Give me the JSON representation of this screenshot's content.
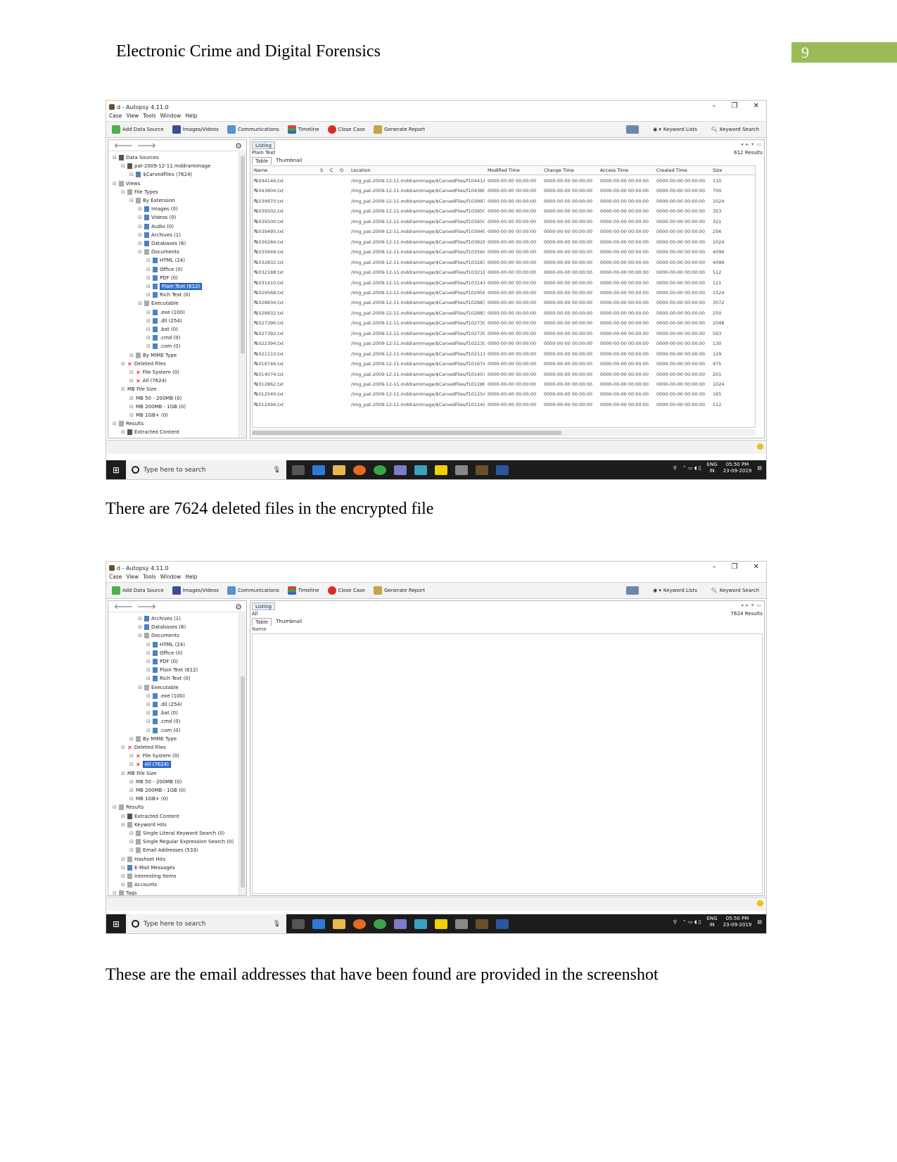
{
  "header": {
    "title": "Electronic Crime and Digital Forensics",
    "page_number": "9"
  },
  "captions": [
    "There are 7624 deleted files in the encrypted file",
    "These are the email addresses that have been found are provided in the screenshot"
  ],
  "app": {
    "window_title": "d - Autopsy 4.11.0",
    "menu": [
      "Case",
      "View",
      "Tools",
      "Window",
      "Help"
    ],
    "toolbar": {
      "add_data_source": "Add Data Source",
      "images_videos": "Images/Videos",
      "communications": "Communications",
      "timeline": "Timeline",
      "close_case": "Close Case",
      "generate_report": "Generate Report",
      "keyword_lists": "Keyword Lists",
      "keyword_search": "Keyword Search"
    },
    "taskbar": {
      "search_placeholder": "Type here to search",
      "lang": "ENG",
      "region": "IN",
      "time": "05:50 PM",
      "date": "23-09-2019"
    }
  },
  "shot1": {
    "tree": [
      {
        "label": "Data Sources",
        "level": 0,
        "icon": "disk"
      },
      {
        "label": "pat-2009-12-11.mddramimage",
        "level": 1,
        "icon": "disk"
      },
      {
        "label": "$CarvedFiles (7624)",
        "level": 2,
        "icon": "folder"
      },
      {
        "label": "Views",
        "level": 0,
        "icon": "gray"
      },
      {
        "label": "File Types",
        "level": 1,
        "icon": "gray"
      },
      {
        "label": "By Extension",
        "level": 2,
        "icon": "gray"
      },
      {
        "label": "Images (0)",
        "level": 3,
        "icon": "folder"
      },
      {
        "label": "Videos (0)",
        "level": 3,
        "icon": "folder"
      },
      {
        "label": "Audio (0)",
        "level": 3,
        "icon": "folder"
      },
      {
        "label": "Archives (1)",
        "level": 3,
        "icon": "folder"
      },
      {
        "label": "Databases (6)",
        "level": 3,
        "icon": "folder"
      },
      {
        "label": "Documents",
        "level": 3,
        "icon": "gray"
      },
      {
        "label": "HTML (24)",
        "level": 4,
        "icon": "folder"
      },
      {
        "label": "Office (0)",
        "level": 4,
        "icon": "folder"
      },
      {
        "label": "PDF (0)",
        "level": 4,
        "icon": "folder"
      },
      {
        "label": "Plain Text (612)",
        "level": 4,
        "icon": "folder",
        "selected": true
      },
      {
        "label": "Rich Text (0)",
        "level": 4,
        "icon": "folder"
      },
      {
        "label": "Executable",
        "level": 3,
        "icon": "gray"
      },
      {
        "label": ".exe (100)",
        "level": 4,
        "icon": "folder"
      },
      {
        "label": ".dll (254)",
        "level": 4,
        "icon": "folder"
      },
      {
        "label": ".bat (0)",
        "level": 4,
        "icon": "folder"
      },
      {
        "label": ".cmd (0)",
        "level": 4,
        "icon": "folder"
      },
      {
        "label": ".com (0)",
        "level": 4,
        "icon": "folder"
      },
      {
        "label": "By MIME Type",
        "level": 2,
        "icon": "gray"
      },
      {
        "label": "Deleted Files",
        "level": 1,
        "icon": "x"
      },
      {
        "label": "File System (0)",
        "level": 2,
        "icon": "x"
      },
      {
        "label": "All (7624)",
        "level": 2,
        "icon": "x"
      },
      {
        "label": "MB File Size",
        "level": 1,
        "icon": "none"
      },
      {
        "label": "MB 50 - 200MB (0)",
        "level": 2,
        "icon": "none"
      },
      {
        "label": "MB 200MB - 1GB (0)",
        "level": 2,
        "icon": "none"
      },
      {
        "label": "MB 1GB+ (0)",
        "level": 2,
        "icon": "none"
      },
      {
        "label": "Results",
        "level": 0,
        "icon": "gray"
      },
      {
        "label": "Extracted Content",
        "level": 1,
        "icon": "disk"
      }
    ],
    "listing_tab": "Listing",
    "listing_sub": "Plain Text",
    "results": "612 Results",
    "tabs": [
      "Table",
      "Thumbnail"
    ],
    "columns": [
      "Name",
      "S",
      "C",
      "O",
      "Location",
      "Modified Time",
      "Change Time",
      "Access Time",
      "Created Time",
      "Size"
    ],
    "rows": [
      {
        "name": "f1044146.txt",
        "loc": "/img_pat-2009-12-11.mddramimage/$CarvedFiles/f104414...",
        "time": "0000-00-00 00:00:00",
        "size": "110"
      },
      {
        "name": "f1043804.txt",
        "loc": "/img_pat-2009-12-11.mddramimage/$CarvedFiles/f104380...",
        "time": "0000-00-00 00:00:00",
        "size": "700"
      },
      {
        "name": "f1039970.txt",
        "loc": "/img_pat-2009-12-11.mddramimage/$CarvedFiles/f103997...",
        "time": "0000-00-00 00:00:00",
        "size": "1024"
      },
      {
        "name": "f1039502.txt",
        "loc": "/img_pat-2009-12-11.mddramimage/$CarvedFiles/f103950...",
        "time": "0000-00-00 00:00:00",
        "size": "353"
      },
      {
        "name": "f1039500.txt",
        "loc": "/img_pat-2009-12-11.mddramimage/$CarvedFiles/f103950...",
        "time": "0000-00-00 00:00:00",
        "size": "321"
      },
      {
        "name": "f1039495.txt",
        "loc": "/img_pat-2009-12-11.mddramimage/$CarvedFiles/f103949...",
        "time": "0000-00-00 00:00:00",
        "size": "256"
      },
      {
        "name": "f1036284.txt",
        "loc": "/img_pat-2009-12-11.mddramimage/$CarvedFiles/f103628...",
        "time": "0000-00-00 00:00:00",
        "size": "1024"
      },
      {
        "name": "f1035648.txt",
        "loc": "/img_pat-2009-12-11.mddramimage/$CarvedFiles/f103564...",
        "time": "0000-00-00 00:00:00",
        "size": "4096"
      },
      {
        "name": "f1032832.txt",
        "loc": "/img_pat-2009-12-11.mddramimage/$CarvedFiles/f103283...",
        "time": "0000-00-00 00:00:00",
        "size": "4096"
      },
      {
        "name": "f1032188.txt",
        "loc": "/img_pat-2009-12-11.mddramimage/$CarvedFiles/f103218...",
        "time": "0000-00-00 00:00:00",
        "size": "512"
      },
      {
        "name": "f1031410.txt",
        "loc": "/img_pat-2009-12-11.mddramimage/$CarvedFiles/f103141...",
        "time": "0000-00-00 00:00:00",
        "size": "121"
      },
      {
        "name": "f1029568.txt",
        "loc": "/img_pat-2009-12-11.mddramimage/$CarvedFiles/f102956...",
        "time": "0000-00-00 00:00:00",
        "size": "1524"
      },
      {
        "name": "f1028834.txt",
        "loc": "/img_pat-2009-12-11.mddramimage/$CarvedFiles/f102883...",
        "time": "0000-00-00 00:00:00",
        "size": "3072"
      },
      {
        "name": "f1028832.txt",
        "loc": "/img_pat-2009-12-11.mddramimage/$CarvedFiles/f102883...",
        "time": "0000-00-00 00:00:00",
        "size": "250"
      },
      {
        "name": "f1027396.txt",
        "loc": "/img_pat-2009-12-11.mddramimage/$CarvedFiles/f102739...",
        "time": "0000-00-00 00:00:00",
        "size": "2048"
      },
      {
        "name": "f1027392.txt",
        "loc": "/img_pat-2009-12-11.mddramimage/$CarvedFiles/f102739...",
        "time": "0000-00-00 00:00:00",
        "size": "593"
      },
      {
        "name": "f1022394.txt",
        "loc": "/img_pat-2009-12-11.mddramimage/$CarvedFiles/f102239...",
        "time": "0000-00-00 00:00:00",
        "size": "130"
      },
      {
        "name": "f1021110.txt",
        "loc": "/img_pat-2009-12-11.mddramimage/$CarvedFiles/f102111...",
        "time": "0000-00-00 00:00:00",
        "size": "129"
      },
      {
        "name": "f1016746.txt",
        "loc": "/img_pat-2009-12-11.mddramimage/$CarvedFiles/f101674...",
        "time": "0000-00-00 00:00:00",
        "size": "975"
      },
      {
        "name": "f1014074.txt",
        "loc": "/img_pat-2009-12-11.mddramimage/$CarvedFiles/f101407...",
        "time": "0000-00-00 00:00:00",
        "size": "201"
      },
      {
        "name": "f1012862.txt",
        "loc": "/img_pat-2009-12-11.mddramimage/$CarvedFiles/f101286...",
        "time": "0000-00-00 00:00:00",
        "size": "1024"
      },
      {
        "name": "f1012540.txt",
        "loc": "/img_pat-2009-12-11.mddramimage/$CarvedFiles/f101254...",
        "time": "0000-00-00 00:00:00",
        "size": "165"
      },
      {
        "name": "f1012494.txt",
        "loc": "/img_pat-2009-12-11.mddramimage/$CarvedFiles/f101249...",
        "time": "0000-00-00 00:00:00",
        "size": "512"
      }
    ]
  },
  "shot2": {
    "tree": [
      {
        "label": "Archives (1)",
        "level": 3,
        "icon": "folder"
      },
      {
        "label": "Databases (6)",
        "level": 3,
        "icon": "folder"
      },
      {
        "label": "Documents",
        "level": 3,
        "icon": "gray"
      },
      {
        "label": "HTML (24)",
        "level": 4,
        "icon": "folder"
      },
      {
        "label": "Office (0)",
        "level": 4,
        "icon": "folder"
      },
      {
        "label": "PDF (0)",
        "level": 4,
        "icon": "folder"
      },
      {
        "label": "Plain Text (612)",
        "level": 4,
        "icon": "folder"
      },
      {
        "label": "Rich Text (0)",
        "level": 4,
        "icon": "folder"
      },
      {
        "label": "Executable",
        "level": 3,
        "icon": "gray"
      },
      {
        "label": ".exe (100)",
        "level": 4,
        "icon": "folder"
      },
      {
        "label": ".dll (254)",
        "level": 4,
        "icon": "folder"
      },
      {
        "label": ".bat (0)",
        "level": 4,
        "icon": "folder"
      },
      {
        "label": ".cmd (0)",
        "level": 4,
        "icon": "folder"
      },
      {
        "label": ".com (0)",
        "level": 4,
        "icon": "folder"
      },
      {
        "label": "By MIME Type",
        "level": 2,
        "icon": "gray"
      },
      {
        "label": "Deleted Files",
        "level": 1,
        "icon": "x"
      },
      {
        "label": "File System (0)",
        "level": 2,
        "icon": "x"
      },
      {
        "label": "All (7624)",
        "level": 2,
        "icon": "x",
        "selected": true
      },
      {
        "label": "MB File Size",
        "level": 1,
        "icon": "none"
      },
      {
        "label": "MB 50 - 200MB (0)",
        "level": 2,
        "icon": "none"
      },
      {
        "label": "MB 200MB - 1GB (0)",
        "level": 2,
        "icon": "none"
      },
      {
        "label": "MB 1GB+ (0)",
        "level": 2,
        "icon": "none"
      },
      {
        "label": "Results",
        "level": 0,
        "icon": "gray"
      },
      {
        "label": "Extracted Content",
        "level": 1,
        "icon": "disk"
      },
      {
        "label": "Keyword Hits",
        "level": 1,
        "icon": "gray"
      },
      {
        "label": "Single Literal Keyword Search (0)",
        "level": 2,
        "icon": "gray"
      },
      {
        "label": "Single Regular Expression Search (0)",
        "level": 2,
        "icon": "gray"
      },
      {
        "label": "Email Addresses (533)",
        "level": 2,
        "icon": "gray"
      },
      {
        "label": "Hashset Hits",
        "level": 1,
        "icon": "gray"
      },
      {
        "label": "E-Mail Messages",
        "level": 1,
        "icon": "folder"
      },
      {
        "label": "Interesting Items",
        "level": 1,
        "icon": "gray"
      },
      {
        "label": "Accounts",
        "level": 1,
        "icon": "gray"
      },
      {
        "label": "Tags",
        "level": 0,
        "icon": "gray"
      }
    ],
    "listing_tab": "Listing",
    "listing_sub": "All",
    "results": "7624 Results",
    "tabs": [
      "Table",
      "Thumbnail"
    ],
    "name_col": "Name"
  },
  "colors": {
    "page_number_bg": "#9bbb59",
    "selection": "#3875d7",
    "taskbar": "#1c1c1c"
  }
}
